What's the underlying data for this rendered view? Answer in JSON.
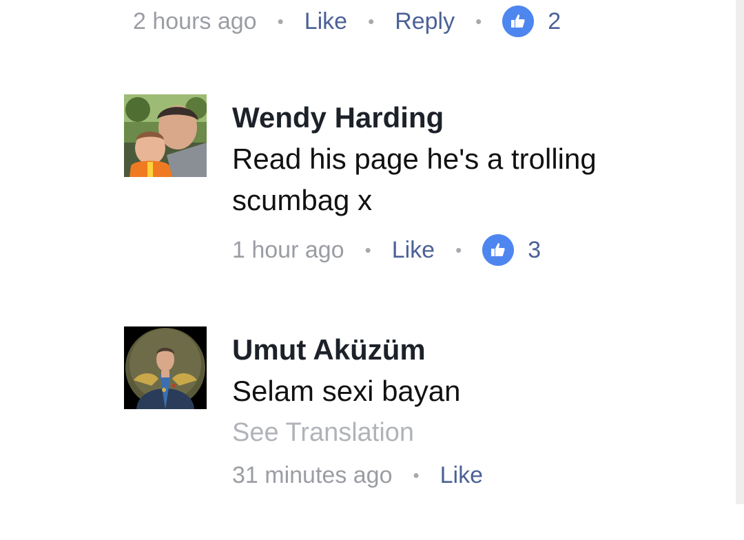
{
  "prev_comment": {
    "time": "2 hours ago",
    "like_label": "Like",
    "reply_label": "Reply",
    "like_count": "2"
  },
  "comments": [
    {
      "author": "Wendy Harding",
      "text": "Read his page he's a trolling scumbag x",
      "time": "1 hour ago",
      "like_label": "Like",
      "like_count": "3"
    },
    {
      "author": "Umut Aküzüm",
      "text": "Selam sexi bayan",
      "see_translation": "See Translation",
      "time": "31 minutes ago",
      "like_label": "Like"
    }
  ],
  "colors": {
    "link": "#4b6196",
    "like_badge": "#4e86f0",
    "meta_text": "#9a9da3",
    "author_text": "#1d2129"
  },
  "icons": [
    "thumbs-up-icon",
    "avatar-photo"
  ]
}
